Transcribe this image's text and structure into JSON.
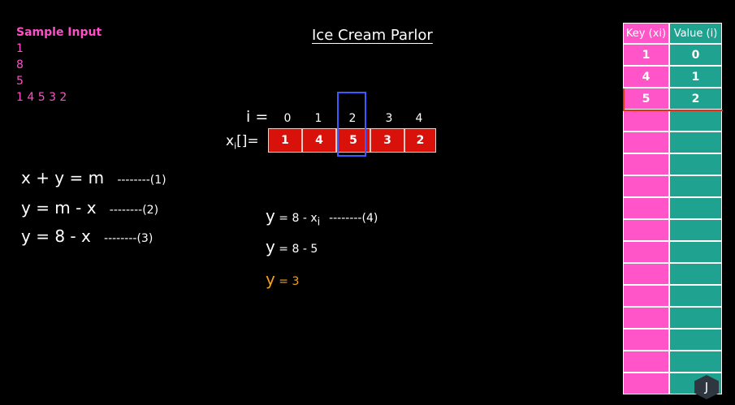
{
  "sample_input": {
    "title": "Sample Input",
    "lines": [
      "1",
      "8",
      "5",
      "1 4 5 3 2"
    ]
  },
  "title": "Ice Cream Parlor",
  "index_label": "i =",
  "indices": [
    "0",
    "1",
    "2",
    "3",
    "4"
  ],
  "array_label_x": "x",
  "array_label_sub": "i",
  "array_label_rest": "[]=",
  "array": [
    "1",
    "4",
    "5",
    "3",
    "2"
  ],
  "highlight_index": 2,
  "left_equations": [
    {
      "main": "x + y = m",
      "tag": "--------(1)"
    },
    {
      "main": "y = m - x",
      "tag": "--------(2)"
    },
    {
      "y": "y",
      "rest": " = 8 - x",
      "tag": "--------(3)"
    }
  ],
  "mid_equations": {
    "eq4": {
      "y": "y",
      "rest": " = 8 - x",
      "sub": "i",
      "tag": "--------(4)"
    },
    "eq5": {
      "y": "y",
      "rest": " = 8 - 5"
    },
    "eq6": {
      "y": "y",
      "rest": " = 3"
    }
  },
  "table": {
    "key_header": "Key (xi)",
    "value_header": "Value (i)",
    "filled_rows": [
      {
        "key": "1",
        "value": "0"
      },
      {
        "key": "4",
        "value": "1"
      },
      {
        "key": "5",
        "value": "2"
      }
    ],
    "empty_rows": 13
  },
  "badge": "J",
  "colors": {
    "pink": "#ff55c9",
    "teal": "#20a290",
    "red": "#d8120a",
    "blue": "#3b5bff",
    "yellow": "#f4a21c"
  }
}
